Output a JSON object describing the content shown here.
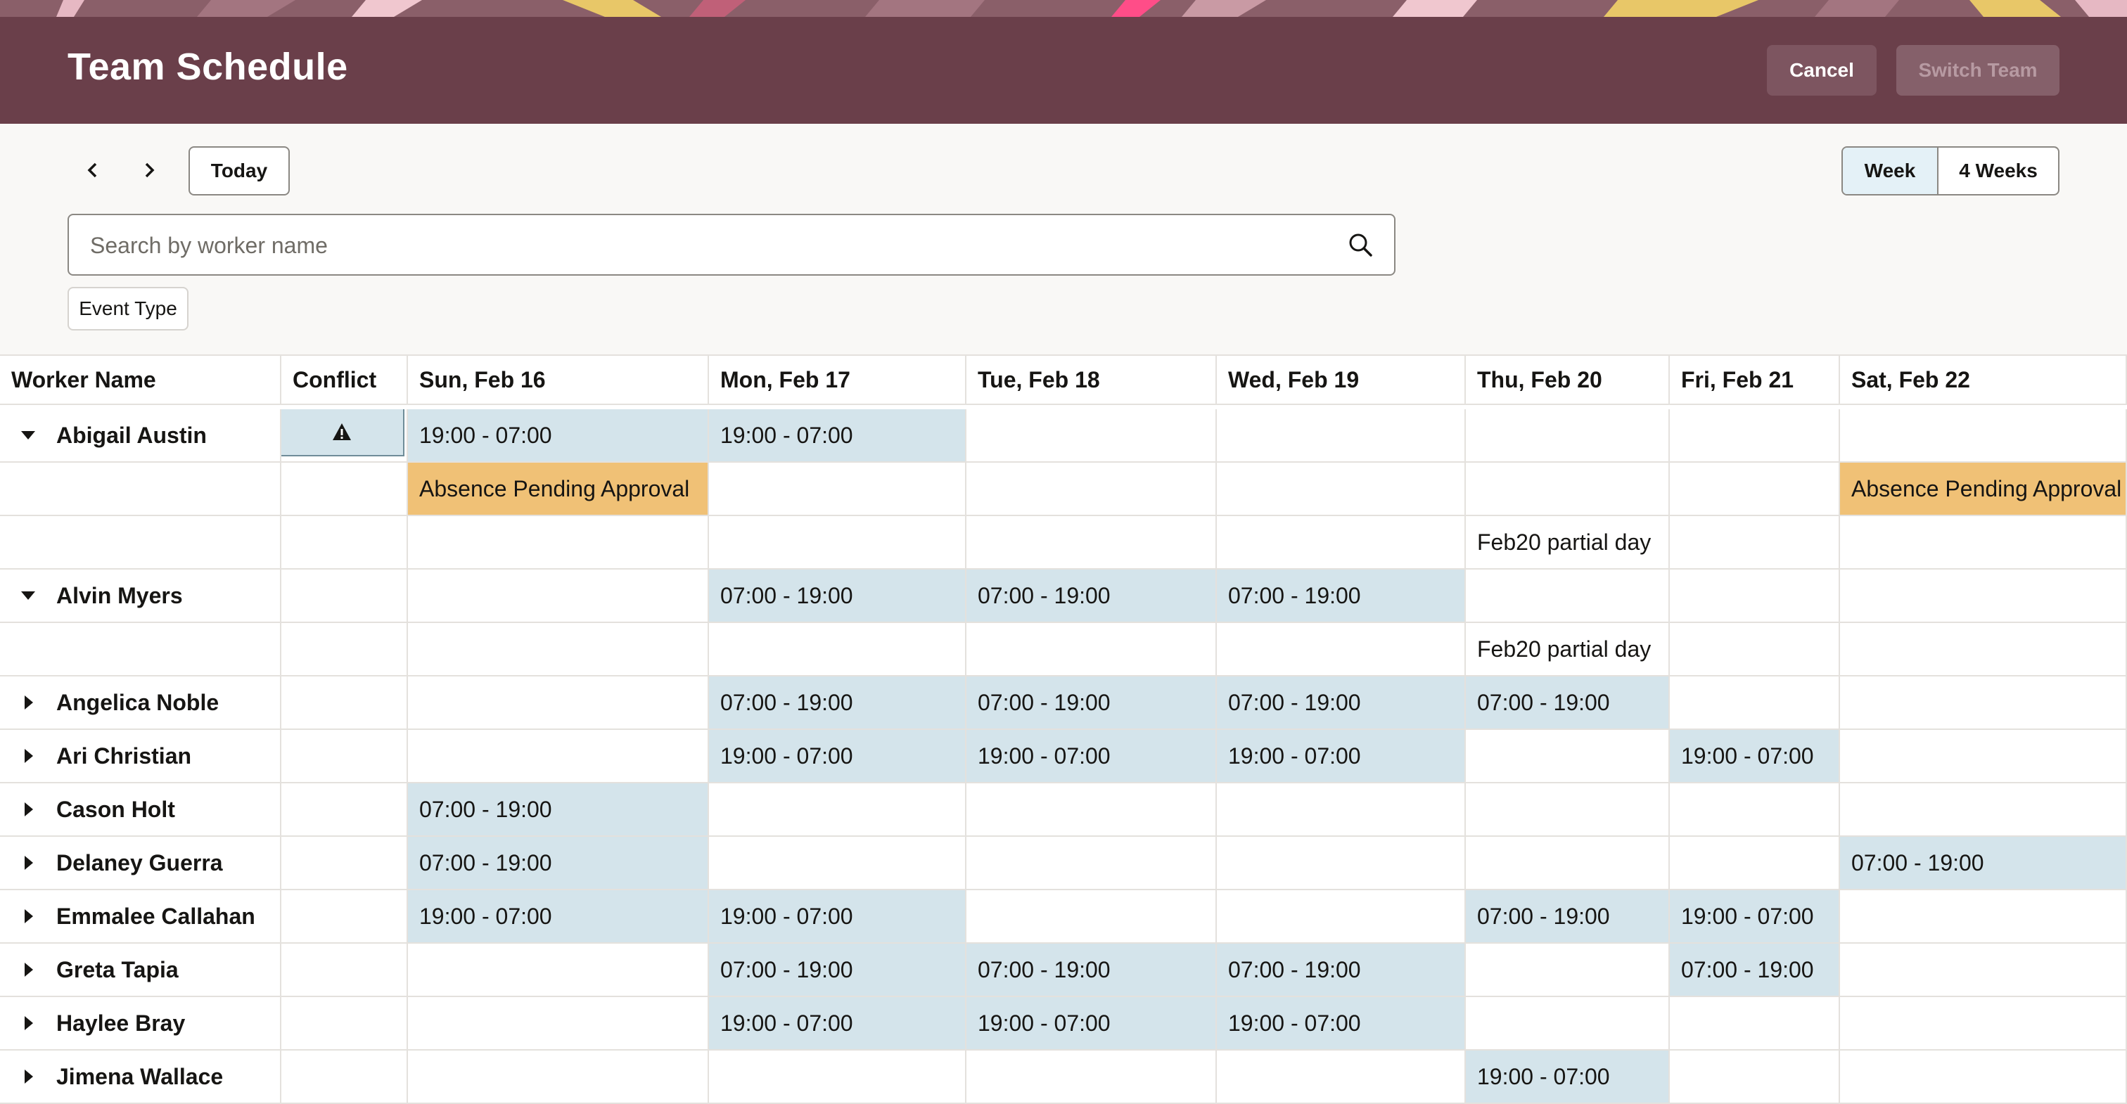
{
  "header": {
    "title": "Team Schedule",
    "cancel_label": "Cancel",
    "switch_team_label": "Switch Team"
  },
  "toolbar": {
    "prev_icon": "chevron-left-icon",
    "next_icon": "chevron-right-icon",
    "today_label": "Today",
    "views": {
      "week": "Week",
      "four_weeks": "4 Weeks",
      "selected": "Week"
    }
  },
  "search": {
    "placeholder": "Search by worker name",
    "value": "",
    "icon": "search-icon"
  },
  "filters": {
    "event_type_label": "Event Type"
  },
  "columns": {
    "worker": "Worker Name",
    "conflict": "Conflict",
    "days": [
      "Sun, Feb 16",
      "Mon, Feb 17",
      "Tue, Feb 18",
      "Wed, Feb 19",
      "Thu, Feb 20",
      "Fri, Feb 21",
      "Sat, Feb 22"
    ]
  },
  "rows": [
    {
      "name": "Abigail Austin",
      "expanded": true,
      "conflict": true,
      "cells": [
        {
          "text": "19:00 - 07:00",
          "kind": "shift"
        },
        {
          "text": "19:00 - 07:00",
          "kind": "shift"
        },
        {
          "text": "",
          "kind": ""
        },
        {
          "text": "",
          "kind": ""
        },
        {
          "text": "",
          "kind": ""
        },
        {
          "text": "",
          "kind": ""
        },
        {
          "text": "",
          "kind": ""
        }
      ]
    },
    {
      "name": "",
      "expanded": null,
      "conflict": false,
      "cells": [
        {
          "text": "Absence Pending Approval",
          "kind": "absence"
        },
        {
          "text": "",
          "kind": ""
        },
        {
          "text": "",
          "kind": ""
        },
        {
          "text": "",
          "kind": ""
        },
        {
          "text": "",
          "kind": ""
        },
        {
          "text": "",
          "kind": ""
        },
        {
          "text": "Absence Pending Approval",
          "kind": "absence"
        }
      ]
    },
    {
      "name": "",
      "expanded": null,
      "conflict": false,
      "cells": [
        {
          "text": "",
          "kind": ""
        },
        {
          "text": "",
          "kind": ""
        },
        {
          "text": "",
          "kind": ""
        },
        {
          "text": "",
          "kind": ""
        },
        {
          "text": "Feb20 partial day",
          "kind": ""
        },
        {
          "text": "",
          "kind": ""
        },
        {
          "text": "",
          "kind": ""
        }
      ]
    },
    {
      "name": "Alvin Myers",
      "expanded": true,
      "conflict": false,
      "cells": [
        {
          "text": "",
          "kind": ""
        },
        {
          "text": "07:00 - 19:00",
          "kind": "shift"
        },
        {
          "text": "07:00 - 19:00",
          "kind": "shift"
        },
        {
          "text": "07:00 - 19:00",
          "kind": "shift"
        },
        {
          "text": "",
          "kind": ""
        },
        {
          "text": "",
          "kind": ""
        },
        {
          "text": "",
          "kind": ""
        }
      ]
    },
    {
      "name": "",
      "expanded": null,
      "conflict": false,
      "cells": [
        {
          "text": "",
          "kind": ""
        },
        {
          "text": "",
          "kind": ""
        },
        {
          "text": "",
          "kind": ""
        },
        {
          "text": "",
          "kind": ""
        },
        {
          "text": "Feb20 partial day",
          "kind": ""
        },
        {
          "text": "",
          "kind": ""
        },
        {
          "text": "",
          "kind": ""
        }
      ]
    },
    {
      "name": "Angelica Noble",
      "expanded": false,
      "conflict": false,
      "cells": [
        {
          "text": "",
          "kind": ""
        },
        {
          "text": "07:00 - 19:00",
          "kind": "shift"
        },
        {
          "text": "07:00 - 19:00",
          "kind": "shift"
        },
        {
          "text": "07:00 - 19:00",
          "kind": "shift"
        },
        {
          "text": "07:00 - 19:00",
          "kind": "shift"
        },
        {
          "text": "",
          "kind": ""
        },
        {
          "text": "",
          "kind": ""
        }
      ]
    },
    {
      "name": "Ari Christian",
      "expanded": false,
      "conflict": false,
      "cells": [
        {
          "text": "",
          "kind": ""
        },
        {
          "text": "19:00 - 07:00",
          "kind": "shift"
        },
        {
          "text": "19:00 - 07:00",
          "kind": "shift"
        },
        {
          "text": "19:00 - 07:00",
          "kind": "shift"
        },
        {
          "text": "",
          "kind": ""
        },
        {
          "text": "19:00 - 07:00",
          "kind": "shift"
        },
        {
          "text": "",
          "kind": ""
        }
      ]
    },
    {
      "name": "Cason Holt",
      "expanded": false,
      "conflict": false,
      "cells": [
        {
          "text": "07:00 - 19:00",
          "kind": "shift"
        },
        {
          "text": "",
          "kind": ""
        },
        {
          "text": "",
          "kind": ""
        },
        {
          "text": "",
          "kind": ""
        },
        {
          "text": "",
          "kind": ""
        },
        {
          "text": "",
          "kind": ""
        },
        {
          "text": "",
          "kind": ""
        }
      ]
    },
    {
      "name": "Delaney Guerra",
      "expanded": false,
      "conflict": false,
      "cells": [
        {
          "text": "07:00 - 19:00",
          "kind": "shift"
        },
        {
          "text": "",
          "kind": ""
        },
        {
          "text": "",
          "kind": ""
        },
        {
          "text": "",
          "kind": ""
        },
        {
          "text": "",
          "kind": ""
        },
        {
          "text": "",
          "kind": ""
        },
        {
          "text": "07:00 - 19:00",
          "kind": "shift"
        }
      ]
    },
    {
      "name": "Emmalee Callahan",
      "expanded": false,
      "conflict": false,
      "cells": [
        {
          "text": "19:00 - 07:00",
          "kind": "shift"
        },
        {
          "text": "19:00 - 07:00",
          "kind": "shift"
        },
        {
          "text": "",
          "kind": ""
        },
        {
          "text": "",
          "kind": ""
        },
        {
          "text": "07:00 - 19:00",
          "kind": "shift"
        },
        {
          "text": "19:00 - 07:00",
          "kind": "shift"
        },
        {
          "text": "",
          "kind": ""
        }
      ]
    },
    {
      "name": "Greta Tapia",
      "expanded": false,
      "conflict": false,
      "cells": [
        {
          "text": "",
          "kind": ""
        },
        {
          "text": "07:00 - 19:00",
          "kind": "shift"
        },
        {
          "text": "07:00 - 19:00",
          "kind": "shift"
        },
        {
          "text": "07:00 - 19:00",
          "kind": "shift"
        },
        {
          "text": "",
          "kind": ""
        },
        {
          "text": "07:00 - 19:00",
          "kind": "shift"
        },
        {
          "text": "",
          "kind": ""
        }
      ]
    },
    {
      "name": "Haylee Bray",
      "expanded": false,
      "conflict": false,
      "cells": [
        {
          "text": "",
          "kind": ""
        },
        {
          "text": "19:00 - 07:00",
          "kind": "shift"
        },
        {
          "text": "19:00 - 07:00",
          "kind": "shift"
        },
        {
          "text": "19:00 - 07:00",
          "kind": "shift"
        },
        {
          "text": "",
          "kind": ""
        },
        {
          "text": "",
          "kind": ""
        },
        {
          "text": "",
          "kind": ""
        }
      ]
    },
    {
      "name": "Jimena Wallace",
      "expanded": false,
      "conflict": false,
      "cells": [
        {
          "text": "",
          "kind": ""
        },
        {
          "text": "",
          "kind": ""
        },
        {
          "text": "",
          "kind": ""
        },
        {
          "text": "",
          "kind": ""
        },
        {
          "text": "19:00 - 07:00",
          "kind": "shift"
        },
        {
          "text": "",
          "kind": ""
        },
        {
          "text": "",
          "kind": ""
        }
      ]
    }
  ],
  "colors": {
    "header_bg": "#6a3f4a",
    "shift_bg": "#d4e4eb",
    "absence_bg": "#f0c176",
    "conflict_outline": "#e3543a",
    "selected_view_bg": "#e4f1f7"
  }
}
